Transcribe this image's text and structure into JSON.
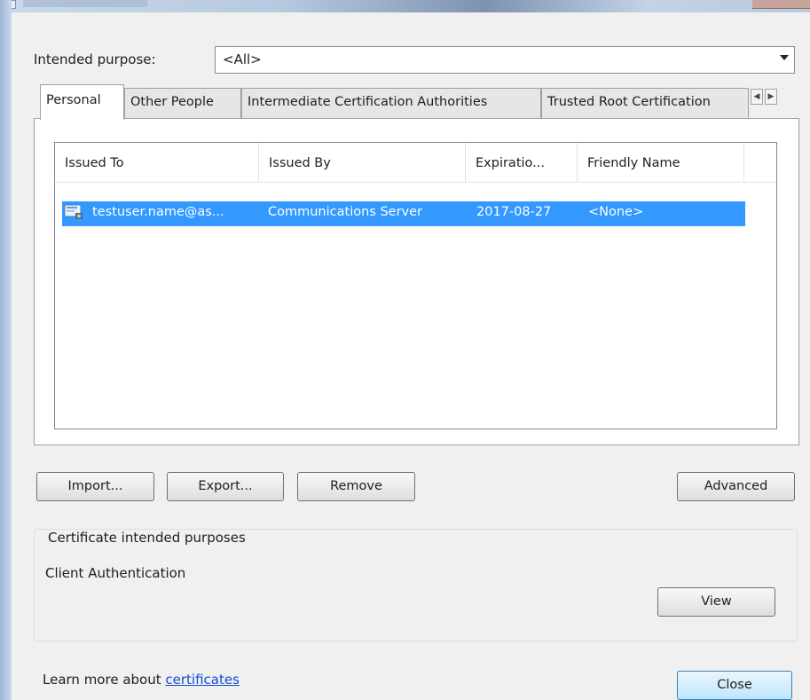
{
  "purpose": {
    "label": "Intended purpose:",
    "value": "<All>"
  },
  "tabs": [
    {
      "label": "Personal"
    },
    {
      "label": "Other People"
    },
    {
      "label": "Intermediate Certification Authorities"
    },
    {
      "label": "Trusted Root Certification"
    }
  ],
  "table": {
    "columns": [
      "Issued To",
      "Issued By",
      "Expiratio...",
      "Friendly Name"
    ],
    "rows": [
      {
        "issued_to": "testuser.name@as...",
        "issued_by": "Communications Server",
        "expiration": "2017-08-27",
        "friendly_name": "<None>"
      }
    ]
  },
  "buttons": {
    "import": "Import...",
    "export": "Export...",
    "remove": "Remove",
    "advanced": "Advanced",
    "view": "View",
    "close": "Close"
  },
  "purposes_group": {
    "title": "Certificate intended purposes",
    "text": "Client Authentication"
  },
  "footer": {
    "learn_more": "Learn more about",
    "link": "certificates"
  },
  "colors": {
    "selection": "#3399ff",
    "link": "#0f4cd6"
  },
  "icons": {
    "certificate": "certificate-icon",
    "dropdown": "chevron-down-icon"
  }
}
